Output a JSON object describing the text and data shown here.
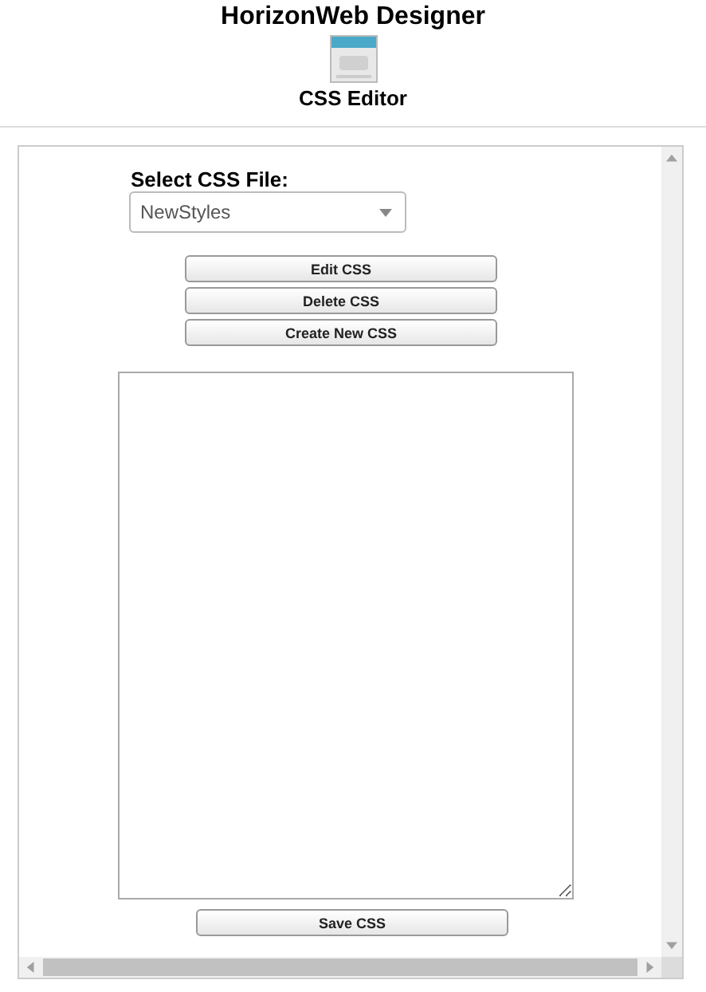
{
  "header": {
    "title": "HorizonWeb Designer",
    "subtitle": "CSS Editor"
  },
  "form": {
    "label": "Select CSS File:",
    "select": {
      "value": "NewStyles"
    },
    "buttons": [
      "Edit CSS",
      "Delete CSS",
      "Create New CSS"
    ],
    "save_button": "Save CSS"
  }
}
